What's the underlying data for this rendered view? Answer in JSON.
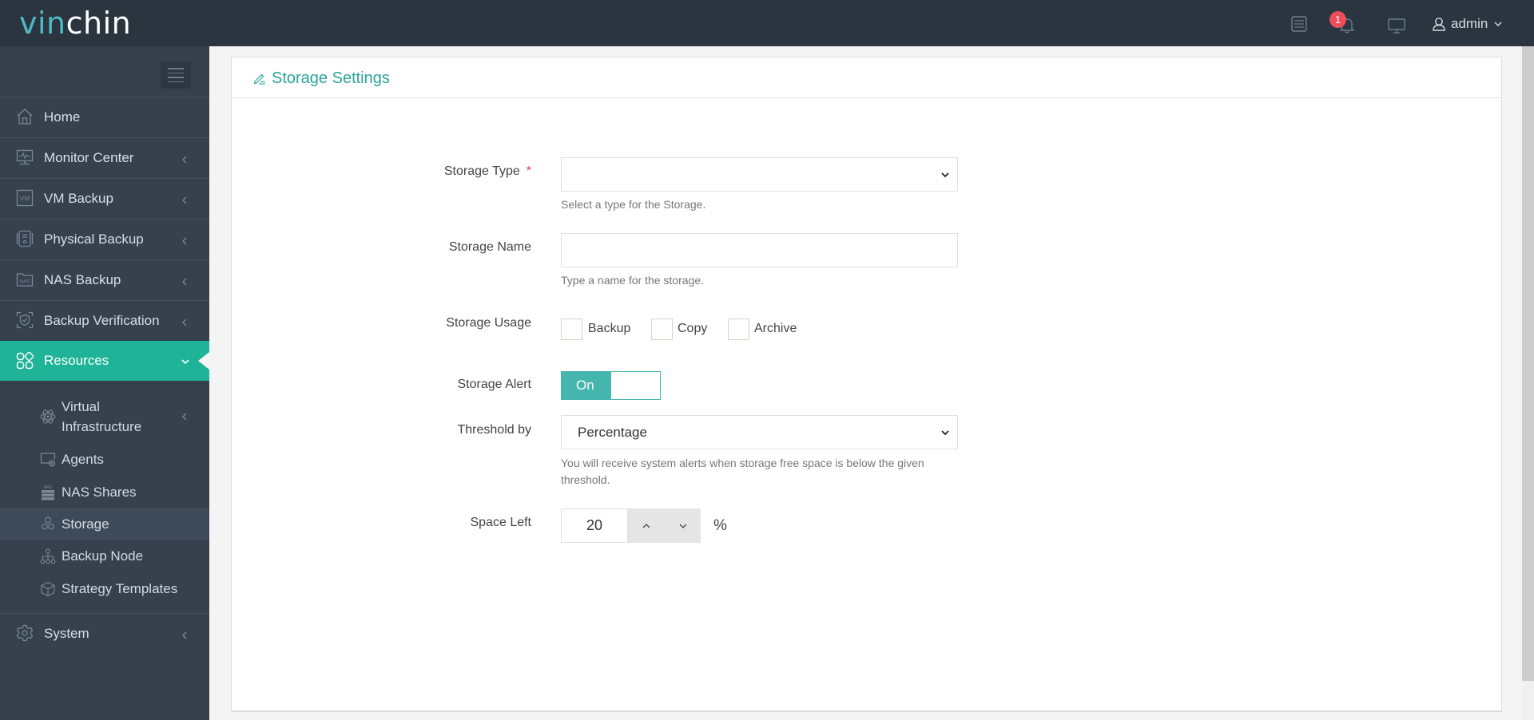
{
  "header": {
    "logo_part1": "vin",
    "logo_part2": "chin",
    "notification_count": "1",
    "user_name": "admin",
    "icons": [
      "task-list-icon",
      "bell-icon",
      "monitor-icon",
      "user-icon",
      "chevron-down-icon"
    ]
  },
  "sidebar": {
    "items": [
      {
        "label": "Home",
        "icon": "home-icon"
      },
      {
        "label": "Monitor Center",
        "icon": "monitor-center-icon",
        "expandable": true
      },
      {
        "label": "VM Backup",
        "icon": "vm-icon",
        "expandable": true
      },
      {
        "label": "Physical Backup",
        "icon": "physical-server-icon",
        "expandable": true
      },
      {
        "label": "NAS Backup",
        "icon": "nas-icon",
        "expandable": true
      },
      {
        "label": "Backup Verification",
        "icon": "shield-check-icon",
        "expandable": true
      },
      {
        "label": "Resources",
        "icon": "grid-icon",
        "expanded": true,
        "active": true
      },
      {
        "label": "System",
        "icon": "gear-icon",
        "expandable": true
      }
    ],
    "resources_sub": [
      {
        "label": "Virtual Infrastructure",
        "line1": "Virtual",
        "line2": "Infrastructure",
        "icon": "atom-icon",
        "expandable": true
      },
      {
        "label": "Agents",
        "icon": "agent-icon"
      },
      {
        "label": "NAS Shares",
        "icon": "nas-shares-icon"
      },
      {
        "label": "Storage",
        "icon": "storage-hexagons-icon",
        "selected": true
      },
      {
        "label": "Backup Node",
        "icon": "node-tree-icon"
      },
      {
        "label": "Strategy Templates",
        "icon": "cube-icon"
      }
    ]
  },
  "panel": {
    "title": "Storage Settings",
    "icon": "edit-icon"
  },
  "form": {
    "storage_type": {
      "label": "Storage Type",
      "required_mark": "*",
      "value": "",
      "help": "Select a type for the Storage."
    },
    "storage_name": {
      "label": "Storage Name",
      "value": "",
      "help": "Type a name for the storage."
    },
    "storage_usage": {
      "label": "Storage Usage",
      "options": [
        {
          "label": "Backup",
          "checked": false
        },
        {
          "label": "Copy",
          "checked": false
        },
        {
          "label": "Archive",
          "checked": false
        }
      ]
    },
    "storage_alert": {
      "label": "Storage Alert",
      "state": "On"
    },
    "threshold_by": {
      "label": "Threshold by",
      "value": "Percentage",
      "help": "You will receive system alerts when storage free space is below the given threshold."
    },
    "space_left": {
      "label": "Space Left",
      "value": "20",
      "unit": "%"
    }
  },
  "colors": {
    "header_bg": "#2b3540",
    "sidebar_bg": "#37414e",
    "active_teal": "#1fb397",
    "accent_teal": "#2aa59a",
    "switch_teal": "#45b6ad",
    "badge_red": "#ee4e5a",
    "logo_teal": "#4fb8c4"
  }
}
